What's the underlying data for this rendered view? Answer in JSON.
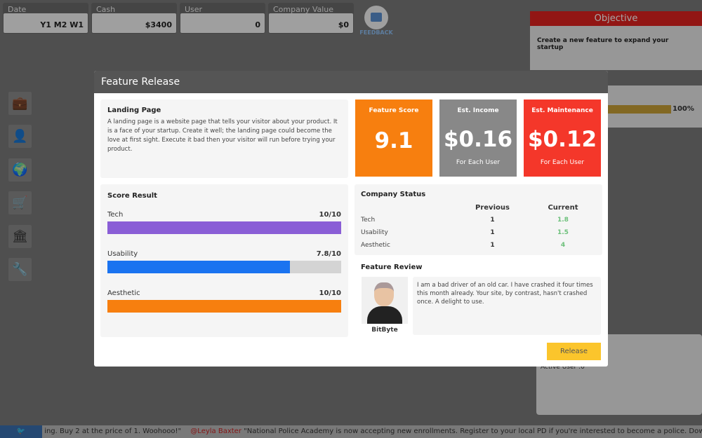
{
  "stats": [
    {
      "label": "Date",
      "value": "Y1 M2 W1"
    },
    {
      "label": "Cash",
      "value": "$3400"
    },
    {
      "label": "User",
      "value": "0"
    },
    {
      "label": "Company Value",
      "value": "$0"
    }
  ],
  "feedback_label": "FEEDBACK",
  "objective": {
    "title": "Objective",
    "text": "Create a new feature to expand your startup"
  },
  "progress": {
    "percent": 100,
    "label": "100%"
  },
  "active_user": "Active User :0",
  "ticker": {
    "text1": "ing. Buy 2 at the price of 1. Woohooo!\"",
    "handle": "@Leyla Baxter",
    "text2": "\"National Police Academy is now accepting new enrollments. Register to your local PD if you're interested to become a police. Download the form her"
  },
  "modal": {
    "title": "Feature Release",
    "feature": {
      "name": "Landing Page",
      "description": "A landing page is a website page that tells your visitor about your product. It is a face of your startup. Create it well; the landing page could become the love at first sight. Execute it bad then your visitor will run before trying your product."
    },
    "cards": [
      {
        "title": "Feature Score",
        "value": "9.1",
        "sub": "",
        "color": "#f77f0f"
      },
      {
        "title": "Est. Income",
        "value": "$0.16",
        "sub": "For Each User",
        "color": "#888888"
      },
      {
        "title": "Est. Maintenance",
        "value": "$0.12",
        "sub": "For Each User",
        "color": "#f4372a"
      }
    ],
    "score_result": {
      "title": "Score Result",
      "items": [
        {
          "label": "Tech",
          "value": "10/10",
          "fraction": 1.0,
          "color": "#8a5ed6"
        },
        {
          "label": "Usability",
          "value": "7.8/10",
          "fraction": 0.78,
          "color": "#1a73f0"
        },
        {
          "label": "Aesthetic",
          "value": "10/10",
          "fraction": 1.0,
          "color": "#f77f0f"
        }
      ]
    },
    "company_status": {
      "title": "Company Status",
      "headers": [
        "Previous",
        "Current"
      ],
      "rows": [
        {
          "label": "Tech",
          "previous": "1",
          "current": "1.8"
        },
        {
          "label": "Usability",
          "previous": "1",
          "current": "1.5"
        },
        {
          "label": "Aesthetic",
          "previous": "1",
          "current": "4"
        }
      ]
    },
    "review": {
      "title": "Feature Review",
      "reviewer": "BitByte",
      "text": "I am a bad driver of an old car. I have crashed it four times this month already. Your site, by contrast, hasn't crashed once. A delight to use."
    },
    "release_label": "Release"
  }
}
